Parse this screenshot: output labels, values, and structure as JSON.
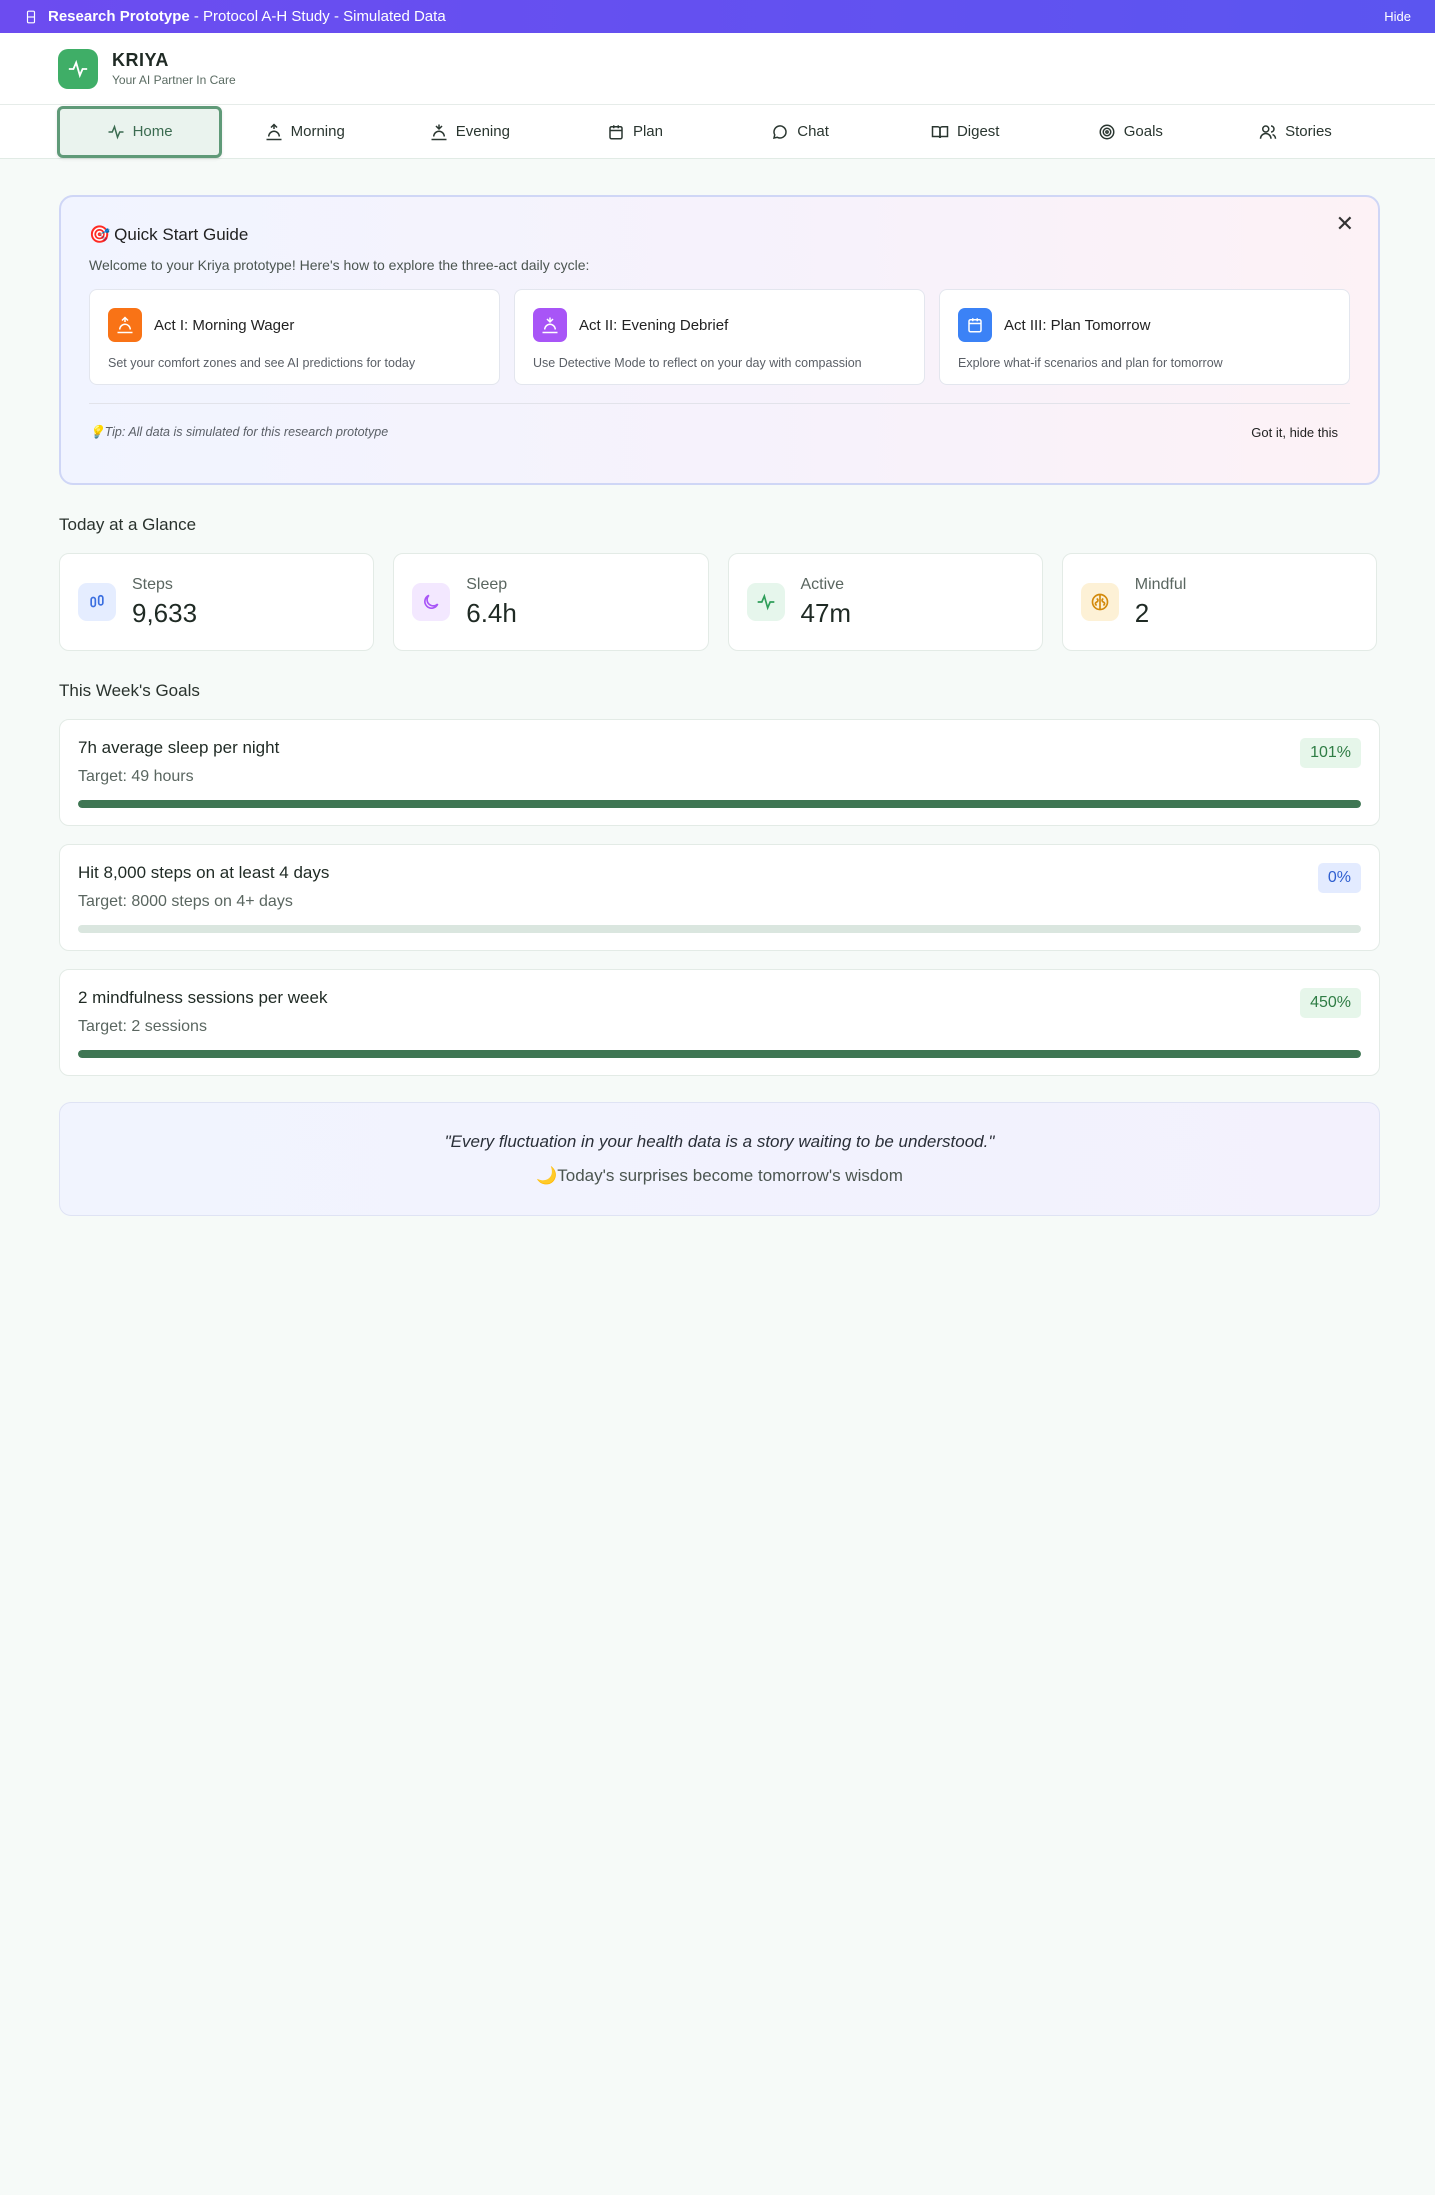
{
  "banner": {
    "title_bold": "Research Prototype",
    "title_rest": " - Protocol A-H Study - Simulated Data",
    "hide_label": "Hide"
  },
  "brand": {
    "name": "KRIYA",
    "tagline": "Your AI Partner In Care",
    "color": "#3fae67"
  },
  "nav": [
    {
      "label": "Home",
      "icon": "activity-icon",
      "active": true
    },
    {
      "label": "Morning",
      "icon": "sunrise-icon"
    },
    {
      "label": "Evening",
      "icon": "sunset-icon"
    },
    {
      "label": "Plan",
      "icon": "calendar-icon"
    },
    {
      "label": "Chat",
      "icon": "chat-icon"
    },
    {
      "label": "Digest",
      "icon": "book-icon"
    },
    {
      "label": "Goals",
      "icon": "target-icon"
    },
    {
      "label": "Stories",
      "icon": "users-icon"
    }
  ],
  "guide": {
    "title": "Quick Start Guide",
    "description": "Welcome to your Kriya prototype! Here's how to explore the three-act daily cycle:",
    "acts": [
      {
        "title": "Act I: Morning Wager",
        "desc": "Set your comfort zones and see AI predictions for today",
        "color": "#f97316"
      },
      {
        "title": "Act II: Evening Debrief",
        "desc": "Use Detective Mode to reflect on your day with compassion",
        "color": "#a855f7"
      },
      {
        "title": "Act III: Plan Tomorrow",
        "desc": "Explore what-if scenarios and plan for tomorrow",
        "color": "#3b82f6"
      }
    ],
    "tip": "Tip: All data is simulated for this research prototype",
    "dismiss_label": "Got it, hide this"
  },
  "glance": {
    "title": "Today at a Glance",
    "stats": [
      {
        "label": "Steps",
        "value": "9,633",
        "icon": "footprints-icon"
      },
      {
        "label": "Sleep",
        "value": "6.4h",
        "icon": "moon-icon"
      },
      {
        "label": "Active",
        "value": "47m",
        "icon": "activity-icon"
      },
      {
        "label": "Mindful",
        "value": "2",
        "icon": "brain-icon"
      }
    ]
  },
  "goals": {
    "title": "This Week's Goals",
    "items": [
      {
        "title": "7h average sleep per night",
        "target": "Target: 49 hours",
        "percent_label": "101%",
        "progress": 1.0
      },
      {
        "title": "Hit 8,000 steps on at least 4 days",
        "target": "Target: 8000 steps on 4+ days",
        "percent_label": "0%",
        "progress": 0
      },
      {
        "title": "2 mindfulness sessions per week",
        "target": "Target: 2 sessions",
        "percent_label": "450%",
        "progress": 1.0
      }
    ]
  },
  "quote": {
    "text": "\"Every fluctuation in your health data is a story waiting to be understood.\"",
    "sub": "Today's surprises become tomorrow's wisdom"
  }
}
